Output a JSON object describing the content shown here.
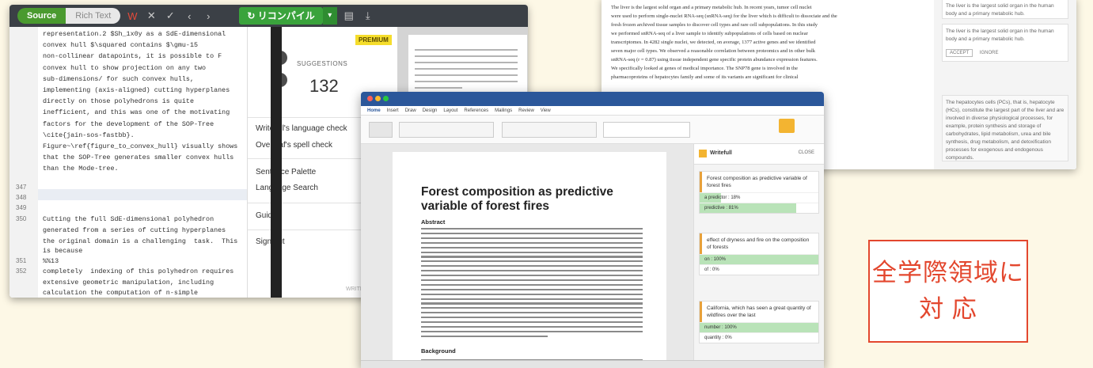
{
  "overleaf": {
    "toggle": {
      "source_label": "Source",
      "rich_label": "Rich Text"
    },
    "recompile_label": "リコンパイル",
    "line_numbers": [
      "347",
      "348",
      "349",
      "350",
      "351",
      "352"
    ],
    "code_lines": [
      "representation.2 $Sh_1x0y as a SdE-dimensional",
      "convex hull $\\squared contains $\\gmu-15",
      "non-collinear datapoints, it is possible to F",
      "convex hull to show projection on any two",
      "sub-dimensions/ for such convex hulls,",
      "implementing (axis-aligned) cutting hyperplanes",
      "directly on those polyhedrons is quite",
      "inefficient, and this was one of the motivating",
      "factors for the development of the SOP-Tree",
      "\\cite{jain-sos-fastbb}.",
      "Figure~\\ref{figure_to_convex_hull} visually shows",
      "that the SOP-Tree generates smaller convex hulls",
      "than the Mode-tree."
    ],
    "code_lines_b": [
      "Cutting the full SdE-dimensional polyhedron",
      "generated from a series of cutting hyperplanes",
      "the original domain is a challenging  task.  This",
      "is because",
      "%%13",
      "completely  indexing of this polyhedron requires",
      "extensive geometric manipulation, including",
      "calculation the computation of n-simple"
    ],
    "menu": {
      "premium_badge": "PREMIUM",
      "suggestions_label": "SUGGESTIONS",
      "suggestions_count": "132",
      "items": [
        "Writefull's language check",
        "Overleaf's spell check",
        "Sentence Palette",
        "Language Search",
        "Guide",
        "Sign out"
      ],
      "version": "WRITEFULL"
    }
  },
  "rightdoc": {
    "lines": [
      "The liver is the largest solid organ and a primary metabolic hub. In recent years, tumor cell nuclei",
      "were used to perform single-nuclei RNA-seq (snRNA-seq) for the liver which is difficult to dissociate and the",
      "fresh frozen archived tissue samples to discover cell types and rare cell subpopulations. In this study",
      "we performed snRNA-seq of a liver sample to identify subpopulations of cells based on nuclear",
      "transcriptomes. In 4282 single nuclei, we detected, on average, 1377 active genes and we identified",
      "seven major cell types. We observed a reasonable correlation between proteomics and in other bulk",
      "snRNA-seq (r = 0.87) using tissue independent gene specific protein abundance expression features.",
      "We specifically looked at genes of medical importance. The SNP78 gene is involved in the",
      "pharmacoproteins of hepatocytes family and some of its variants are significant for clinical"
    ],
    "side_cards": [
      "The liver is the largest solid organ in the human body and a primary metabolic hub.",
      "The liver is the largest solid organ in the human body and a primary metabolic hub.",
      "The hepatocytes cells (PCs), that is, hepatocyte (HCs), constitute the largest part of the liver and are involved in diverse physiological processes, for example, protein synthesis and storage of carbohydrates, lipid metabolism, urea and bile synthesis, drug metabolism, and detoxification processes for exogenous and endogenous compounds."
    ],
    "accept_label": "ACCEPT",
    "ignore_label": "IGNORE"
  },
  "word": {
    "tabs": [
      "Home",
      "Insert",
      "Draw",
      "Design",
      "Layout",
      "References",
      "Mailings",
      "Review",
      "View"
    ],
    "doc_title": "Forest composition as predictive variable of forest fires",
    "abstract_heading": "Abstract",
    "background_heading": "Background",
    "pane_title": "Writefull",
    "pane_close": "CLOSE",
    "cards": [
      {
        "text": "Forest composition as predictive variable of forest fires",
        "options": [
          {
            "label": "a predictor : 18%",
            "pct": 18
          },
          {
            "label": "predictive : 81%",
            "pct": 81
          }
        ]
      },
      {
        "text": "effect of dryness and fire on the composition of forests",
        "options": [
          {
            "label": "on : 100%",
            "pct": 100
          },
          {
            "label": "of : 0%",
            "pct": 0
          }
        ]
      },
      {
        "text": "California, which has seen a great quantity of wildfires over the last",
        "options": [
          {
            "label": "number : 100%",
            "pct": 100
          },
          {
            "label": "quantity : 0%",
            "pct": 0
          }
        ]
      }
    ]
  },
  "callout": {
    "line1": "全学際領域に",
    "line2": "対 応"
  },
  "colors": {
    "accent_red": "#e3472e",
    "overleaf_green": "#3aa33c",
    "word_blue": "#2b579a",
    "writefull_yellow": "#f3b431"
  }
}
